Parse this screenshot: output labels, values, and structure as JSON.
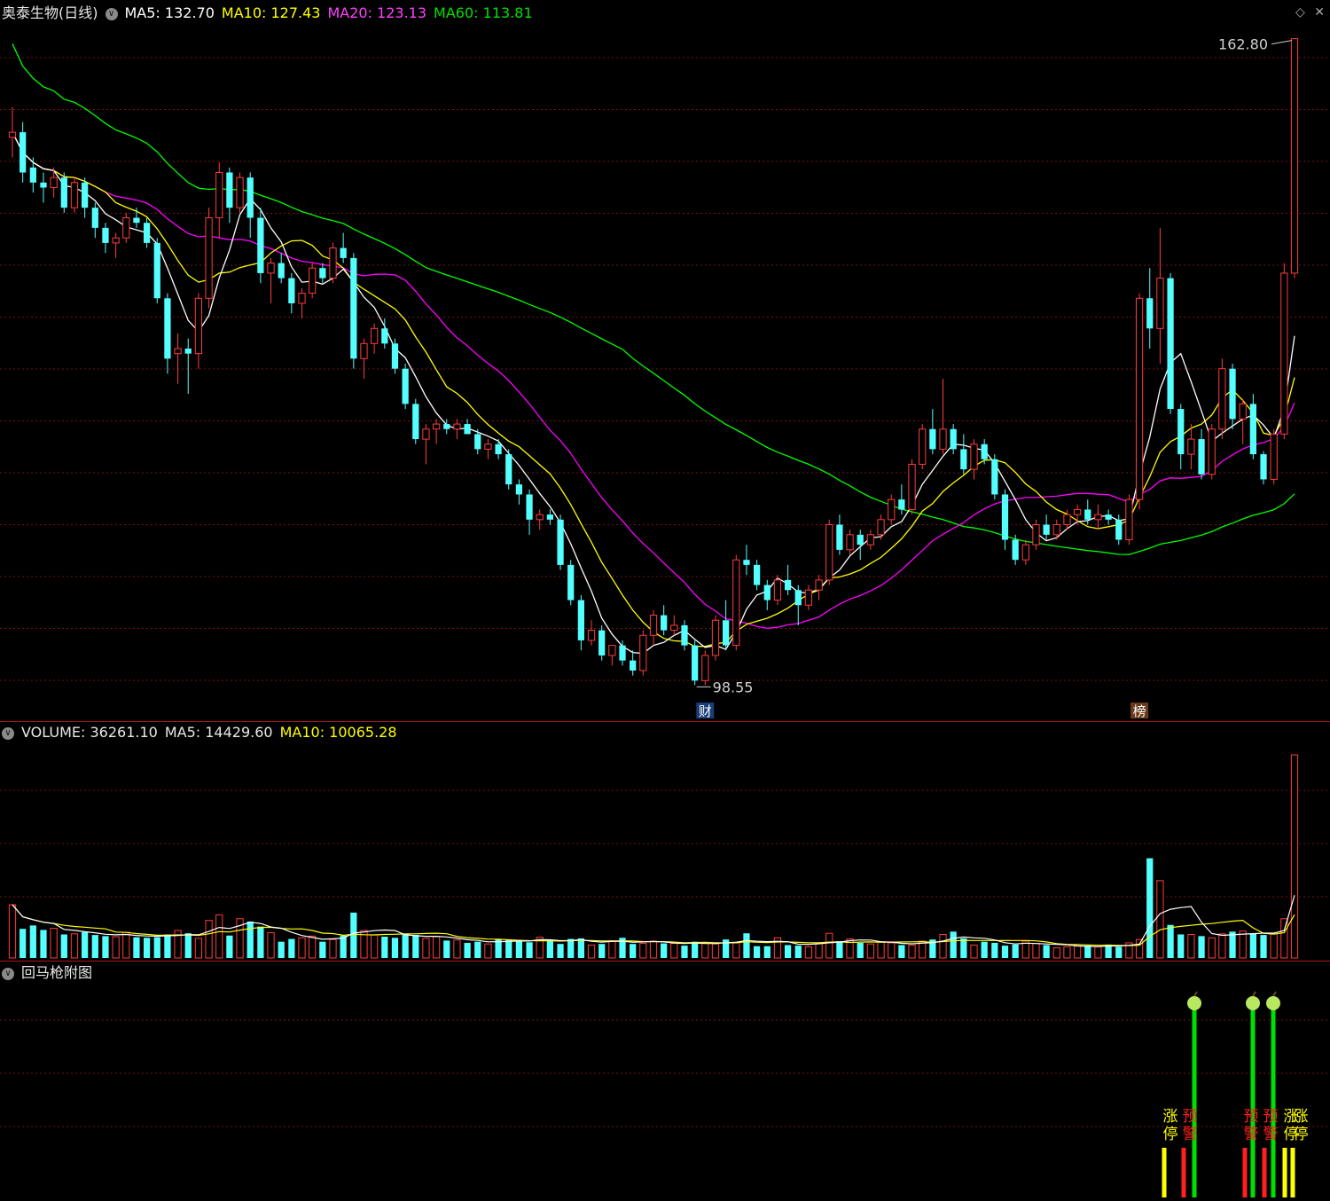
{
  "header": {
    "stock_name": "奥泰生物(日线)",
    "ma5_label": "MA5: 132.70",
    "ma10_label": "MA10: 127.43",
    "ma20_label": "MA20: 123.13",
    "ma60_label": "MA60: 113.81"
  },
  "volume_header": {
    "volume_label": "VOLUME: 36261.10",
    "ma5_label": "MA5: 14429.60",
    "ma10_label": "MA10: 10065.28"
  },
  "indicator_header": {
    "title": "回马枪附图"
  },
  "icons": {
    "collapse": "chevron-down-icon",
    "top_right": [
      "diamond-icon",
      "close-icon"
    ]
  },
  "colors": {
    "up": "#ff3c3c",
    "down": "#54ffff",
    "ma5": "#ffffff",
    "ma10": "#ffff00",
    "ma20": "#ff00ff",
    "ma60": "#00ff00",
    "grid": "#7a1010",
    "separator": "#b01818"
  },
  "chart_data": [
    {
      "type": "candlestick",
      "panel": "price",
      "annotations": {
        "high_label": "162.80",
        "low_label": "98.55",
        "event_tags": [
          "财",
          "榜"
        ]
      },
      "ohlc": [
        [
          153.0,
          156.0,
          151.0,
          153.5
        ],
        [
          153.5,
          154.5,
          148.5,
          149.5
        ],
        [
          150.0,
          151.0,
          147.5,
          148.5
        ],
        [
          148.5,
          149.5,
          146.5,
          148.0
        ],
        [
          148.0,
          150.0,
          147.0,
          149.0
        ],
        [
          149.0,
          149.5,
          145.5,
          146.0
        ],
        [
          146.0,
          149.0,
          145.5,
          148.5
        ],
        [
          148.5,
          149.0,
          145.0,
          146.0
        ],
        [
          146.0,
          146.5,
          143.0,
          144.0
        ],
        [
          144.0,
          144.5,
          141.5,
          142.5
        ],
        [
          142.5,
          143.5,
          141.0,
          143.0
        ],
        [
          143.0,
          145.5,
          142.5,
          145.0
        ],
        [
          145.0,
          146.0,
          144.0,
          144.5
        ],
        [
          144.5,
          145.0,
          142.0,
          142.5
        ],
        [
          142.5,
          143.0,
          136.5,
          137.0
        ],
        [
          137.0,
          137.5,
          129.5,
          131.0
        ],
        [
          131.5,
          133.5,
          128.5,
          132.0
        ],
        [
          132.0,
          133.0,
          127.5,
          131.5
        ],
        [
          131.5,
          137.5,
          130.0,
          137.0
        ],
        [
          137.0,
          146.0,
          136.0,
          145.0
        ],
        [
          145.0,
          150.5,
          143.0,
          149.5
        ],
        [
          149.5,
          150.0,
          144.5,
          146.0
        ],
        [
          146.0,
          149.5,
          145.5,
          149.0
        ],
        [
          149.0,
          149.5,
          143.0,
          145.0
        ],
        [
          145.0,
          146.0,
          138.5,
          139.5
        ],
        [
          139.5,
          141.0,
          136.5,
          140.5
        ],
        [
          140.5,
          141.5,
          138.5,
          139.0
        ],
        [
          139.0,
          139.5,
          135.5,
          136.5
        ],
        [
          136.5,
          138.0,
          135.0,
          137.5
        ],
        [
          137.5,
          140.5,
          137.0,
          140.0
        ],
        [
          140.0,
          140.5,
          138.5,
          139.0
        ],
        [
          139.0,
          142.5,
          138.5,
          142.0
        ],
        [
          142.0,
          143.5,
          140.5,
          141.0
        ],
        [
          141.0,
          141.5,
          130.0,
          131.0
        ],
        [
          131.0,
          133.0,
          129.0,
          132.5
        ],
        [
          132.5,
          134.5,
          131.5,
          134.0
        ],
        [
          134.0,
          135.0,
          132.0,
          132.5
        ],
        [
          132.5,
          133.0,
          129.5,
          130.0
        ],
        [
          130.0,
          130.5,
          126.0,
          126.5
        ],
        [
          126.5,
          127.0,
          122.5,
          123.0
        ],
        [
          123.0,
          124.5,
          120.5,
          124.0
        ],
        [
          124.0,
          125.0,
          122.5,
          124.5
        ],
        [
          124.5,
          125.0,
          123.5,
          124.0
        ],
        [
          124.0,
          125.0,
          123.0,
          124.5
        ],
        [
          124.5,
          125.0,
          123.5,
          123.5
        ],
        [
          123.5,
          124.0,
          121.5,
          122.0
        ],
        [
          122.0,
          123.0,
          121.0,
          122.5
        ],
        [
          122.5,
          123.0,
          121.0,
          121.5
        ],
        [
          121.5,
          122.0,
          118.0,
          118.5
        ],
        [
          118.5,
          119.0,
          116.5,
          117.5
        ],
        [
          117.5,
          118.0,
          113.5,
          115.0
        ],
        [
          115.0,
          116.0,
          114.0,
          115.5
        ],
        [
          115.5,
          116.0,
          114.5,
          115.0
        ],
        [
          115.0,
          115.5,
          110.0,
          110.5
        ],
        [
          110.5,
          111.0,
          106.5,
          107.0
        ],
        [
          107.0,
          107.5,
          102.0,
          103.0
        ],
        [
          103.0,
          105.0,
          102.5,
          104.0
        ],
        [
          104.0,
          104.5,
          101.0,
          101.5
        ],
        [
          101.5,
          102.5,
          100.5,
          102.5
        ],
        [
          102.5,
          103.0,
          100.5,
          101.0
        ],
        [
          101.0,
          102.0,
          99.5,
          100.0
        ],
        [
          100.0,
          104.0,
          99.5,
          103.5
        ],
        [
          103.5,
          106.0,
          102.5,
          105.5
        ],
        [
          105.5,
          106.5,
          103.5,
          104.0
        ],
        [
          104.0,
          105.5,
          103.5,
          104.5
        ],
        [
          104.5,
          105.0,
          102.0,
          102.5
        ],
        [
          102.5,
          103.0,
          98.55,
          99.0
        ],
        [
          99.0,
          102.0,
          98.55,
          101.5
        ],
        [
          101.5,
          105.5,
          101.0,
          105.0
        ],
        [
          105.0,
          107.0,
          102.0,
          102.5
        ],
        [
          102.5,
          111.5,
          102.0,
          111.0
        ],
        [
          111.0,
          112.5,
          109.5,
          110.5
        ],
        [
          110.5,
          111.0,
          108.0,
          108.5
        ],
        [
          108.5,
          109.0,
          106.0,
          107.0
        ],
        [
          107.0,
          109.5,
          106.5,
          109.0
        ],
        [
          109.0,
          110.5,
          107.5,
          108.0
        ],
        [
          108.0,
          108.5,
          104.5,
          106.5
        ],
        [
          106.5,
          108.5,
          106.0,
          108.0
        ],
        [
          108.0,
          109.5,
          107.0,
          109.0
        ],
        [
          109.0,
          115.0,
          108.5,
          114.5
        ],
        [
          114.5,
          115.5,
          111.5,
          112.0
        ],
        [
          112.0,
          114.0,
          111.5,
          113.5
        ],
        [
          113.5,
          114.0,
          111.0,
          112.5
        ],
        [
          112.5,
          114.0,
          112.0,
          113.5
        ],
        [
          113.5,
          115.5,
          113.0,
          115.0
        ],
        [
          115.0,
          117.5,
          114.5,
          117.0
        ],
        [
          117.0,
          118.5,
          115.5,
          116.0
        ],
        [
          116.0,
          121.0,
          115.5,
          120.5
        ],
        [
          120.5,
          124.5,
          120.0,
          124.0
        ],
        [
          124.0,
          126.0,
          121.5,
          122.0
        ],
        [
          122.0,
          129.0,
          121.5,
          124.0
        ],
        [
          124.0,
          124.5,
          121.5,
          122.0
        ],
        [
          122.0,
          123.5,
          119.5,
          120.0
        ],
        [
          120.0,
          123.0,
          119.0,
          122.5
        ],
        [
          122.5,
          123.0,
          120.5,
          121.0
        ],
        [
          121.0,
          121.5,
          117.0,
          117.5
        ],
        [
          117.5,
          118.0,
          112.0,
          113.0
        ],
        [
          113.0,
          113.5,
          110.5,
          111.0
        ],
        [
          111.0,
          113.0,
          110.5,
          112.5
        ],
        [
          112.5,
          115.0,
          112.0,
          114.5
        ],
        [
          114.5,
          115.5,
          113.0,
          113.5
        ],
        [
          113.5,
          115.0,
          113.0,
          114.5
        ],
        [
          114.5,
          116.0,
          114.0,
          115.5
        ],
        [
          115.5,
          116.5,
          114.5,
          116.0
        ],
        [
          116.0,
          117.0,
          114.5,
          115.0
        ],
        [
          115.0,
          116.5,
          114.0,
          115.5
        ],
        [
          115.5,
          116.0,
          114.5,
          115.0
        ],
        [
          115.0,
          115.5,
          112.5,
          113.0
        ],
        [
          113.0,
          117.5,
          112.5,
          117.0
        ],
        [
          117.0,
          137.5,
          116.0,
          137.0
        ],
        [
          137.0,
          140.0,
          132.0,
          134.0
        ],
        [
          134.0,
          144.0,
          130.5,
          139.0
        ],
        [
          139.0,
          139.5,
          125.5,
          126.0
        ],
        [
          126.0,
          126.5,
          120.0,
          121.5
        ],
        [
          121.5,
          124.5,
          120.0,
          123.0
        ],
        [
          123.0,
          124.0,
          119.0,
          119.5
        ],
        [
          119.5,
          124.5,
          119.0,
          124.0
        ],
        [
          124.0,
          131.0,
          123.0,
          130.0
        ],
        [
          130.0,
          130.5,
          124.0,
          125.0
        ],
        [
          125.0,
          127.0,
          122.5,
          126.5
        ],
        [
          126.5,
          127.5,
          121.0,
          121.5
        ],
        [
          121.5,
          121.8,
          118.5,
          119.0
        ],
        [
          119.0,
          124.0,
          118.5,
          123.5
        ],
        [
          123.5,
          140.5,
          123.0,
          139.5
        ],
        [
          139.5,
          162.8,
          139.0,
          162.8
        ]
      ],
      "ma5_end": 132.7,
      "ma10_end": 127.43,
      "ma20_end": 123.13,
      "ma60_end": 113.81,
      "ylim": [
        97.0,
        164.0
      ]
    },
    {
      "type": "bar",
      "panel": "volume",
      "values": [
        9500,
        5200,
        5800,
        5000,
        5300,
        4200,
        4300,
        4600,
        4100,
        3900,
        3800,
        4600,
        3700,
        3600,
        3700,
        4200,
        4900,
        4400,
        3500,
        6700,
        7700,
        4000,
        7000,
        6500,
        5600,
        4500,
        2900,
        3400,
        3600,
        3900,
        2900,
        3300,
        4000,
        8100,
        4900,
        4100,
        3800,
        3600,
        4300,
        4100,
        3500,
        3800,
        3100,
        3200,
        2700,
        2900,
        2500,
        3300,
        3300,
        3200,
        2800,
        3700,
        3200,
        2500,
        3400,
        3500,
        2300,
        2500,
        3100,
        3600,
        2500,
        2600,
        3000,
        2600,
        2600,
        2200,
        2900,
        2700,
        2500,
        3300,
        2700,
        4400,
        2100,
        2100,
        3600,
        2300,
        2200,
        2000,
        2600,
        4400,
        3000,
        3400,
        2700,
        2500,
        2900,
        2700,
        2300,
        2300,
        3000,
        3300,
        4200,
        4700,
        3500,
        2300,
        2900,
        2700,
        2200,
        2400,
        3000,
        2600,
        2300,
        1800,
        2000,
        2100,
        2200,
        2000,
        2400,
        2000,
        2700,
        3300,
        17800,
        13800,
        5900,
        4200,
        4200,
        3900,
        3600,
        4300,
        4700,
        4800,
        4300,
        4100,
        4300,
        7000,
        36261
      ],
      "ylim": [
        0,
        38000
      ]
    },
    {
      "type": "bar",
      "panel": "indicator",
      "series": [
        {
          "name": "涨停",
          "color": "#ffff00",
          "values": [
            1.0,
            1.0,
            1.0
          ]
        },
        {
          "name": "预警",
          "color": "#ff2020",
          "values": [
            1.0,
            1.0,
            1.0
          ]
        },
        {
          "name": "回马枪",
          "color": "#00e000",
          "values": [
            1.0,
            1.0,
            1.0
          ]
        }
      ],
      "signal_labels": [
        "涨停",
        "预警",
        "预警",
        "预警",
        "涨停",
        "涨停"
      ]
    }
  ]
}
